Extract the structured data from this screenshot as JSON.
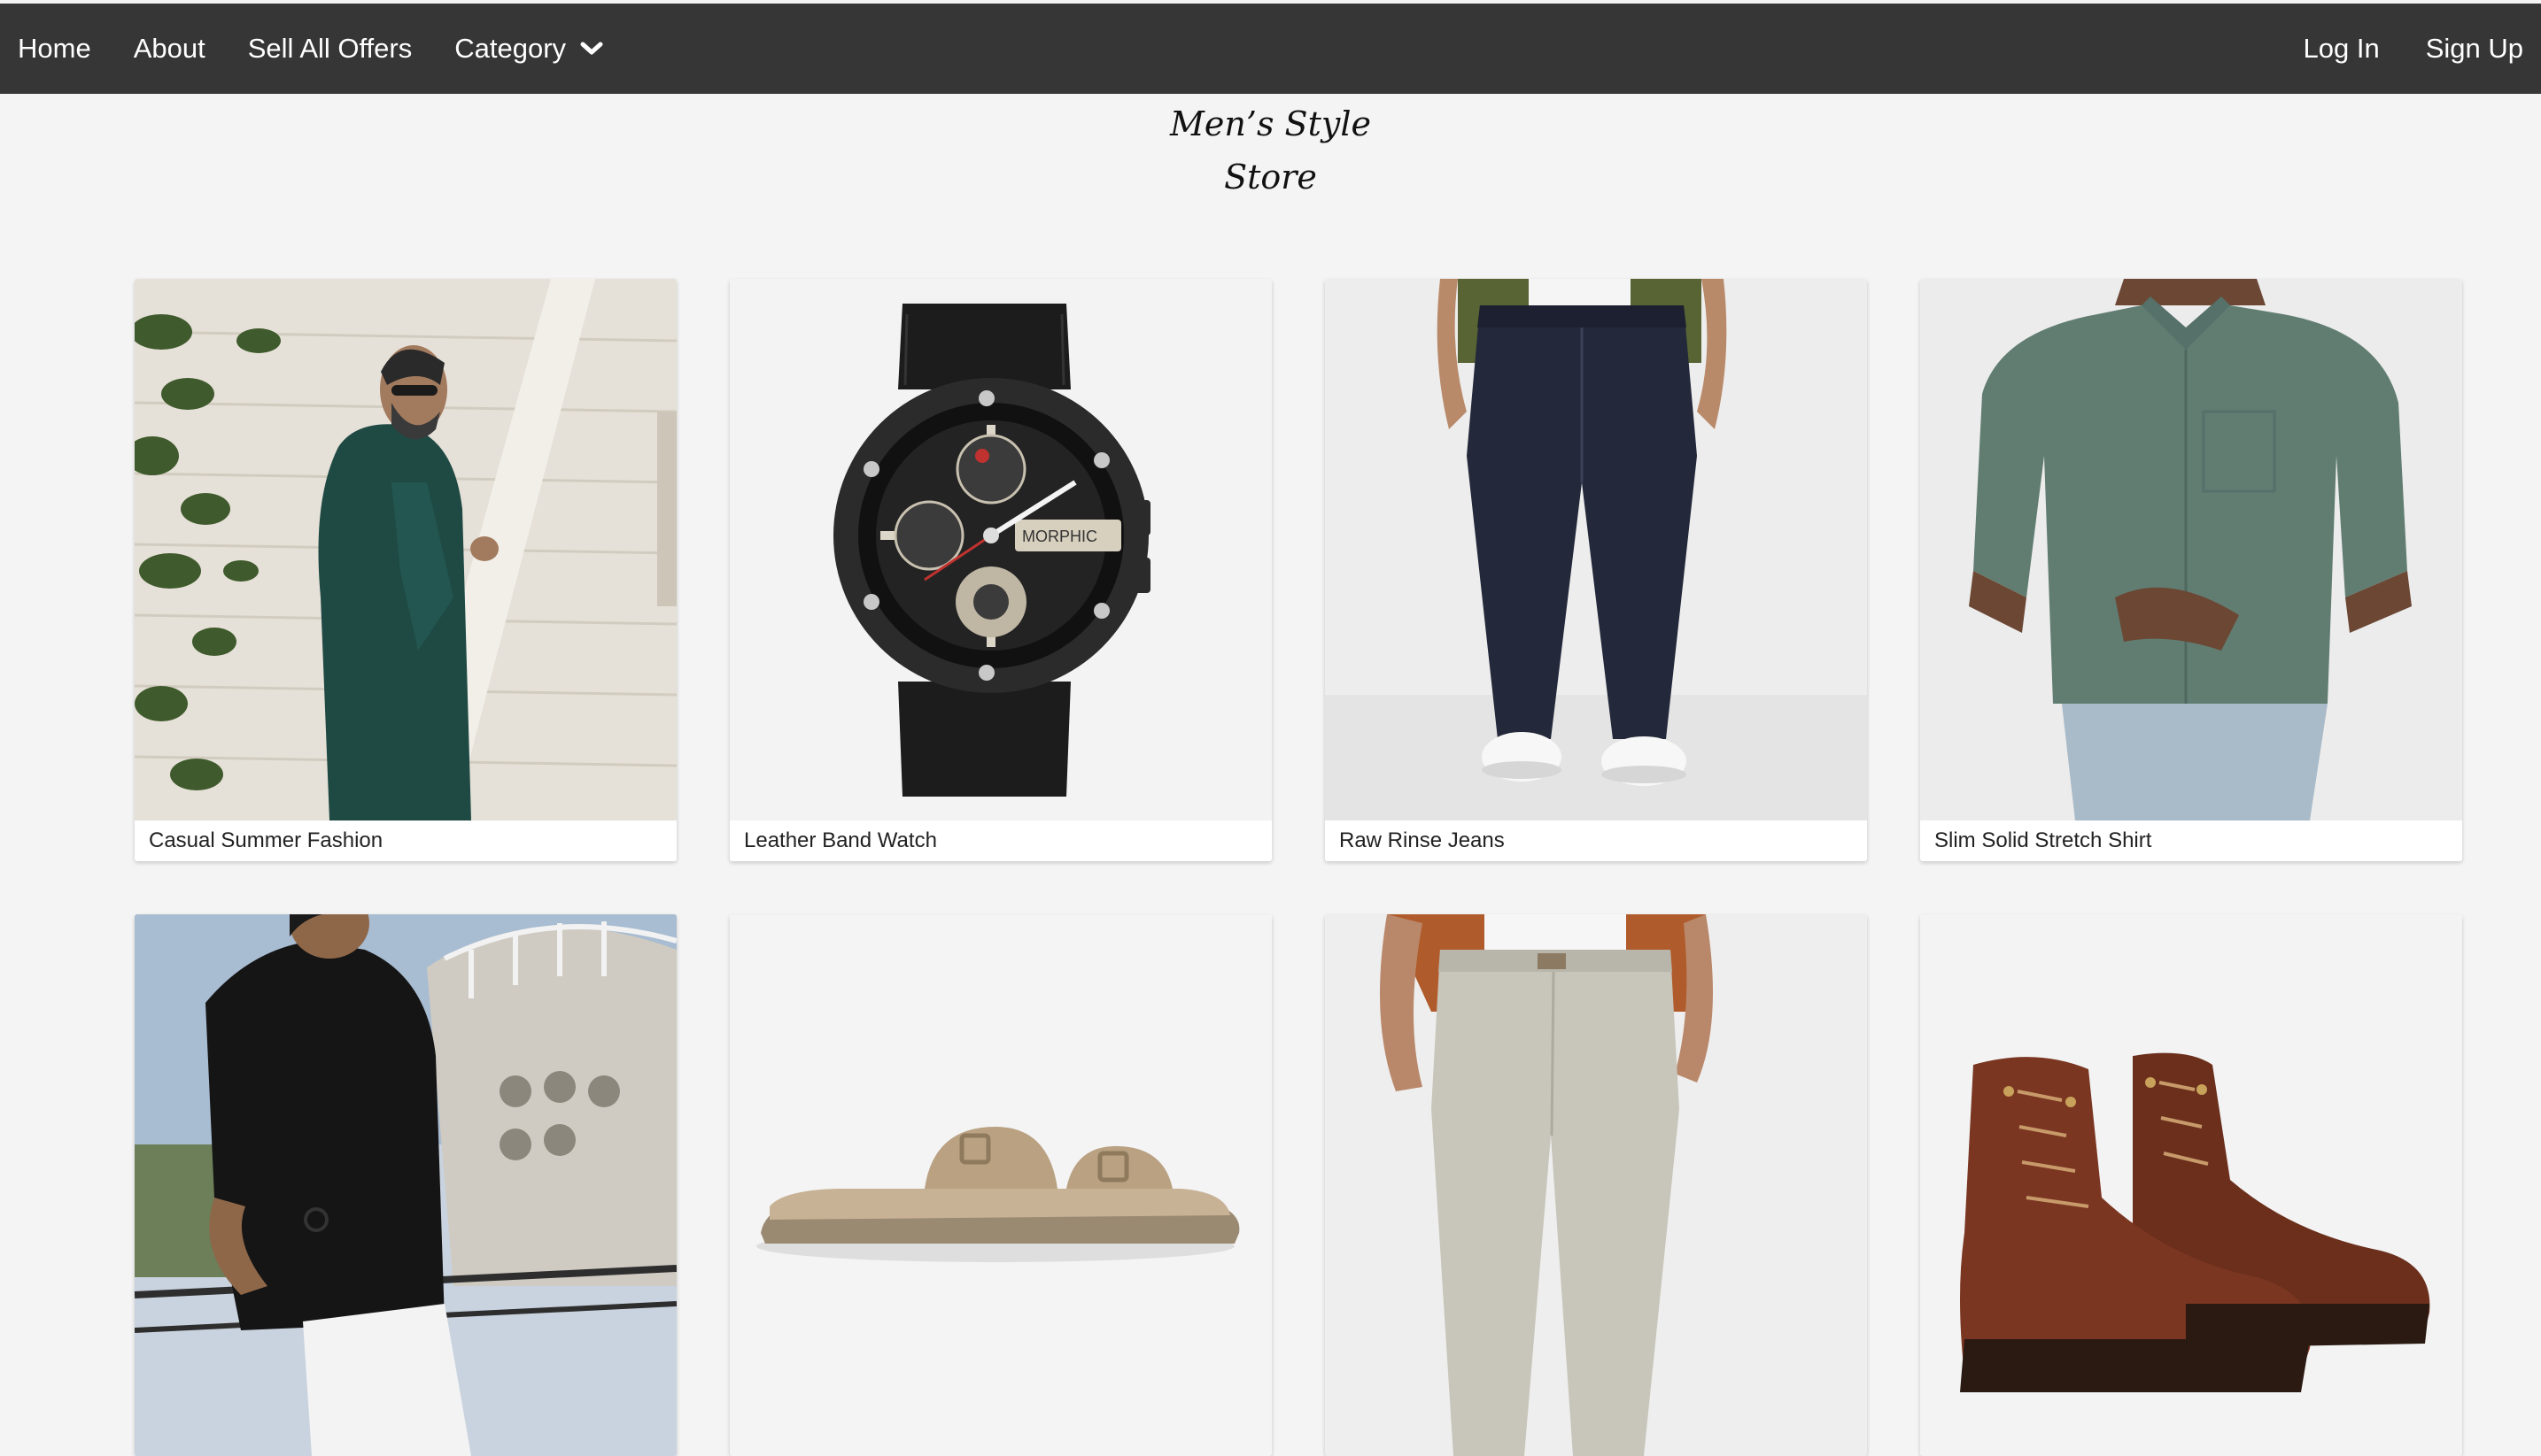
{
  "nav": {
    "home": "Home",
    "about": "About",
    "offers": "Sell All Offers",
    "category": "Category",
    "login": "Log In",
    "signup": "Sign Up"
  },
  "store": {
    "title_line1": "Men’s Style",
    "title_line2": "Store"
  },
  "products": [
    {
      "label": "Casual Summer Fashion",
      "image": "man-green-shirt-photo"
    },
    {
      "label": "Leather Band Watch",
      "image": "watch-photo"
    },
    {
      "label": "Raw Rinse Jeans",
      "image": "jeans-photo"
    },
    {
      "label": "Slim Solid Stretch Shirt",
      "image": "shirt-photo"
    },
    {
      "label": "",
      "image": "black-shirt-photo"
    },
    {
      "label": "",
      "image": "sandal-photo"
    },
    {
      "label": "",
      "image": "chinos-photo"
    },
    {
      "label": "",
      "image": "boots-photo"
    }
  ],
  "colors": {
    "navbar": "#363636",
    "background": "#f4f4f4",
    "card": "#ffffff"
  }
}
